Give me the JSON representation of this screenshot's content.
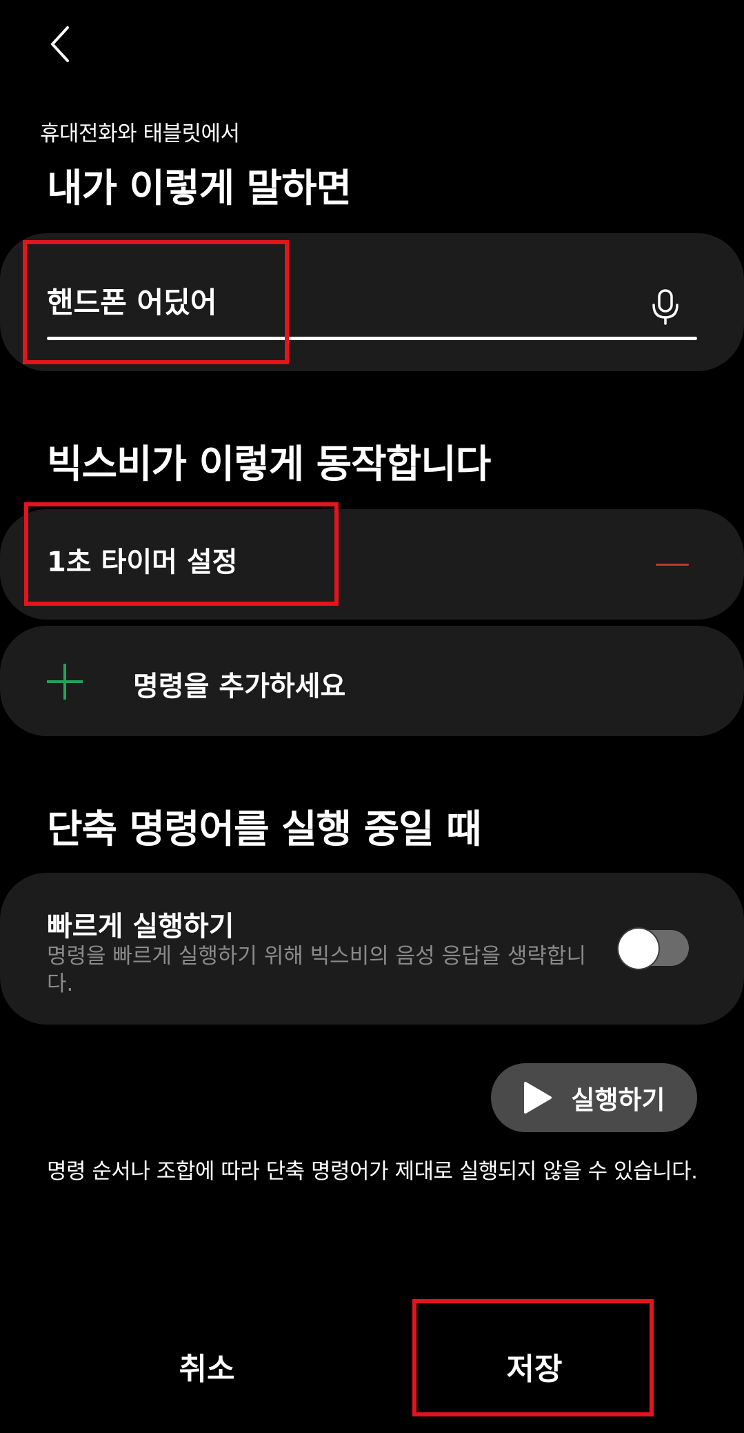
{
  "header": {
    "back_icon": "chevron-left-icon",
    "subtitle": "휴대전화와 태블릿에서"
  },
  "trigger_section": {
    "title": "내가 이렇게 말하면",
    "phrase_value": "핸드폰 어딨어",
    "mic_icon": "microphone-icon"
  },
  "action_section": {
    "title": "빅스비가 이렇게 동작합니다",
    "actions": [
      {
        "label": "1초 타이머 설정",
        "remove_icon": "minus-icon"
      }
    ],
    "add_label": "명령을 추가하세요",
    "add_icon": "plus-icon"
  },
  "running_section": {
    "title": "단축 명령어를 실행 중일 때",
    "quick_run": {
      "title": "빠르게 실행하기",
      "description": "명령을 빠르게 실행하기 위해 빅스비의 음성 응답을 생략합니다.",
      "enabled": false
    }
  },
  "run_button": {
    "label": "실행하기",
    "icon": "play-icon"
  },
  "note": "명령 순서나 조합에 따라 단축 명령어가 제대로 실행되지 않을 수 있습니다.",
  "footer": {
    "cancel_label": "취소",
    "save_label": "저장"
  },
  "colors": {
    "background": "#000000",
    "card": "#1c1c1c",
    "accent_green": "#22a35a",
    "remove_red": "#c0392b",
    "highlight_red": "#e0151d",
    "secondary_text": "#8a8a8a"
  }
}
